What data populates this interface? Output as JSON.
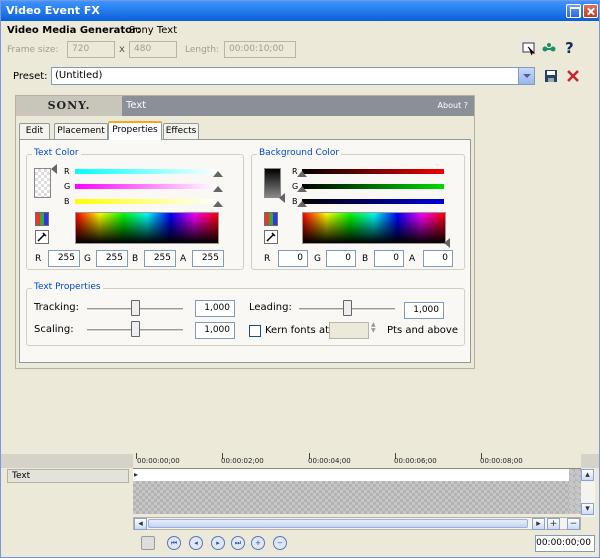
{
  "window": {
    "title": "Video Event FX"
  },
  "generator": {
    "label": "Video Media Generator:",
    "name": "Sony Text"
  },
  "frame": {
    "size_label": "Frame size:",
    "width": "720",
    "x": "x",
    "height": "480",
    "length_label": "Length:",
    "length": "00:00:10;00"
  },
  "preset": {
    "label": "Preset:",
    "value": "(Untitled)"
  },
  "plugin": {
    "brand": "SONY.",
    "name": "Text",
    "about": "About  ?"
  },
  "tabs": [
    {
      "label": "Edit"
    },
    {
      "label": "Placement"
    },
    {
      "label": "Properties"
    },
    {
      "label": "Effects"
    }
  ],
  "text_color": {
    "title": "Text Color",
    "channels": [
      "R",
      "G",
      "B"
    ],
    "fields": [
      {
        "label": "R",
        "value": "255"
      },
      {
        "label": "G",
        "value": "255"
      },
      {
        "label": "B",
        "value": "255"
      },
      {
        "label": "A",
        "value": "255"
      }
    ]
  },
  "background_color": {
    "title": "Background Color",
    "channels": [
      "R",
      "G",
      "B"
    ],
    "fields": [
      {
        "label": "R",
        "value": "0"
      },
      {
        "label": "G",
        "value": "0"
      },
      {
        "label": "B",
        "value": "0"
      },
      {
        "label": "A",
        "value": "0"
      }
    ]
  },
  "text_properties": {
    "title": "Text Properties",
    "tracking_label": "Tracking:",
    "tracking_value": "1,000",
    "tracking_level": 0.5,
    "scaling_label": "Scaling:",
    "scaling_value": "1,000",
    "scaling_level": 0.5,
    "leading_label": "Leading:",
    "leading_value": "1,000",
    "leading_level": 0.5,
    "kern_label": "Kern fonts at:",
    "kern_suffix": "Pts and above",
    "kern_checked": false
  },
  "timeline": {
    "track_name": "Text",
    "ruler": [
      "00:00:00;00",
      "00:00:02;00",
      "00:00:04;00",
      "00:00:06;00",
      "00:00:08;00"
    ],
    "timecode": "00:00:00;00"
  },
  "colors": {
    "accent": "#0046d5",
    "title_bar": "#0a5fd8",
    "tab_highlight": "#f5a623",
    "close_red": "#c2262b"
  }
}
